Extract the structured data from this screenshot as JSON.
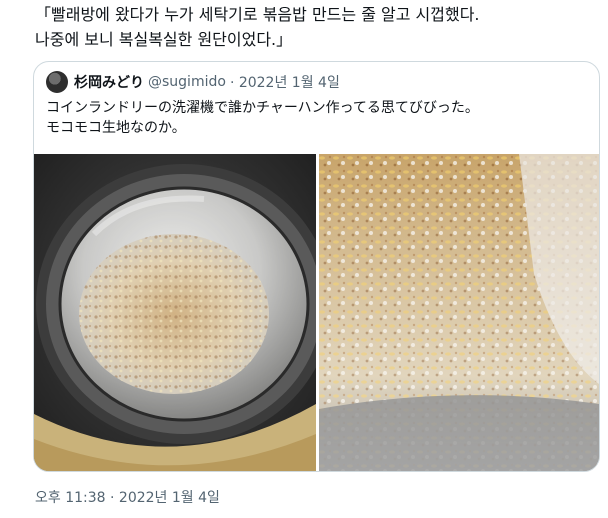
{
  "tweet": {
    "text_lines": [
      "「빨래방에 왔다가 누가 세탁기로 볶음밥 만드는 줄 알고 시껍했다.",
      "나중에 보니 복실복실한 원단이었다.」"
    ],
    "timestamp": "오후 11:38 · 2022년 1월 4일"
  },
  "quoted_tweet": {
    "display_name": "杉岡みどり",
    "handle": "@sugimido",
    "date": "· 2022년 1월 4일",
    "text_lines": [
      "コインランドリーの洗濯機で誰かチャーハン作ってる思てびびった。",
      "モコモコ生地なのか。"
    ]
  },
  "colors": {
    "border": "#cfd9de",
    "secondary_text": "#536471",
    "primary_text": "#0f1419"
  }
}
